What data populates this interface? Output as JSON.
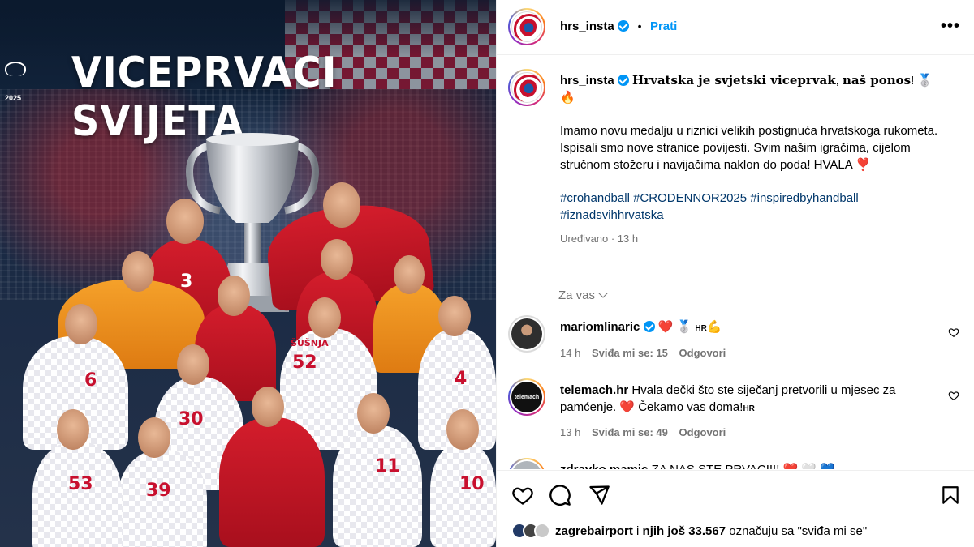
{
  "post_image": {
    "headline": "VICEPRVACI SVIJETA",
    "event_year": "2025",
    "jersey_numbers": [
      "3",
      "52",
      "6",
      "30",
      "39",
      "53",
      "11",
      "10",
      "4"
    ],
    "jersey_name": "ŠUŠNJA"
  },
  "header": {
    "username": "hrs_insta",
    "follow_label": "Prati",
    "more_icon": "ellipsis-icon"
  },
  "caption": {
    "username": "hrs_insta",
    "title_bold_1": "Hrvatska je svjetski viceprvak",
    "title_sep": ", ",
    "title_bold_2": "naš ponos",
    "title_end": "! 🥈",
    "title_line2": "🔥",
    "body": "Imamo novu medalju u riznici velikih postignuća hrvatskoga rukometa. Ispisali smo nove stranice povijesti. Svim našim igračima, cijelom stručnom stožeru i navijačima naklon do poda! HVALA ❣️",
    "hashtags": "#crohandball #CRODENNOR2025 #inspiredbyhandball #iznadsvihhrvatska",
    "edited": "Uređivano · 13 h"
  },
  "for_you_label": "Za vas",
  "comments": [
    {
      "username": "mariomlinaric",
      "text": "❤️ 🥈 ",
      "flag": "HR",
      "after_flag": "💪",
      "time": "14 h",
      "likes": "Sviđa mi se: 15",
      "reply": "Odgovori"
    },
    {
      "username": "telemach.hr",
      "text": "Hvala dečki što ste siječanj pretvorili u mjesec za pamćenje. ❤️ Čekamo vas doma!",
      "flag": "HR",
      "time": "13 h",
      "likes": "Sviđa mi se: 49",
      "reply": "Odgovori"
    },
    {
      "username": "zdravko.mamic",
      "text": "ZA NAS STE PRVACI!!! ❤️ 🤍 💙"
    }
  ],
  "actions": {
    "like_icon": "heart-icon",
    "comment_icon": "comment-icon",
    "share_icon": "share-icon",
    "save_icon": "bookmark-icon"
  },
  "likes": {
    "first_liker": "zagrebairport",
    "middle": " i ",
    "others_bold": "njih još 33.567",
    "suffix": " označuju sa \"sviđa mi se\""
  },
  "colors": {
    "accent": "#0095f6",
    "hashtag": "#00376b",
    "muted": "#737373",
    "croatia_red": "#c8102e"
  }
}
